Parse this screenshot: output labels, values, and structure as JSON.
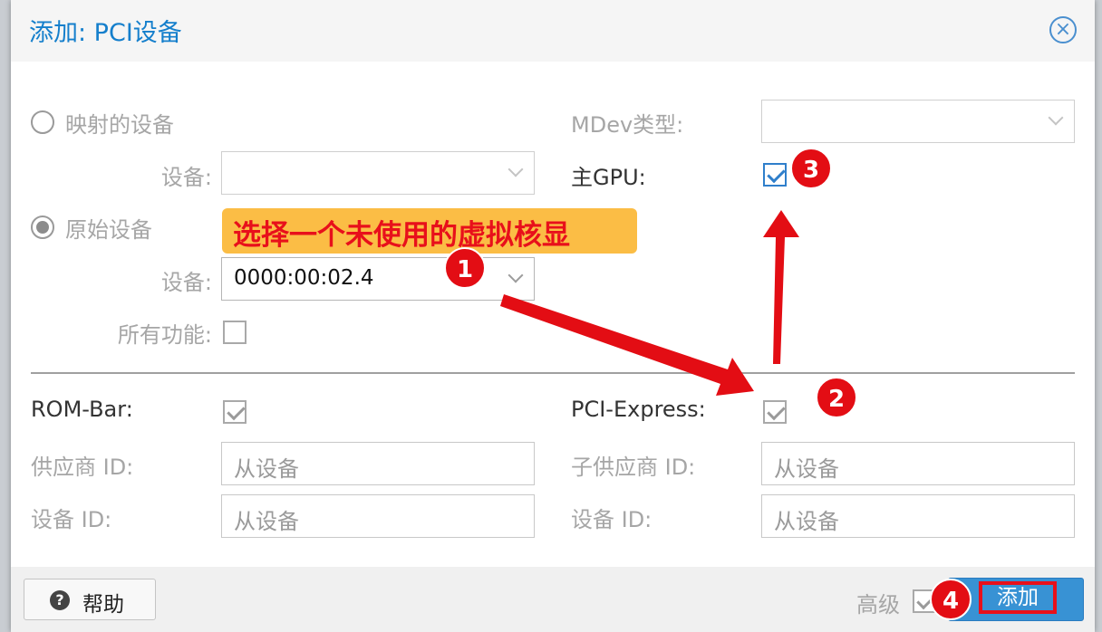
{
  "dialog": {
    "title": "添加: PCI设备",
    "close_icon": "close-circle-icon"
  },
  "mapped": {
    "radio_label": "映射的设备",
    "device_label": "设备:",
    "device_value": "",
    "selected": false
  },
  "raw": {
    "radio_label": "原始设备",
    "device_label": "设备:",
    "device_value": "0000:00:02.4",
    "all_functions_label": "所有功能:",
    "all_functions_checked": false,
    "selected": true
  },
  "right": {
    "mdev_label": "MDev类型:",
    "mdev_value": "",
    "primary_gpu_label": "主GPU:",
    "primary_gpu_checked": true
  },
  "advanced": {
    "rombar_label": "ROM-Bar:",
    "rombar_checked": true,
    "pcie_label": "PCI-Express:",
    "pcie_checked": true,
    "vendor_id_label": "供应商 ID:",
    "vendor_id_placeholder": "从设备",
    "sub_vendor_id_label": "子供应商 ID:",
    "sub_vendor_id_placeholder": "从设备",
    "device_id_label": "设备 ID:",
    "device_id_placeholder": "从设备",
    "sub_device_id_label": "设备 ID:",
    "sub_device_id_placeholder": "从设备"
  },
  "footer": {
    "help_label": "帮助",
    "help_icon": "question-circle-icon",
    "advanced_label": "高级",
    "advanced_checked": true,
    "add_label": "添加"
  },
  "annotations": {
    "callout_text": "选择一个未使用的虚拟核显",
    "badges": [
      "1",
      "2",
      "3",
      "4"
    ],
    "color": "#e30d14"
  }
}
